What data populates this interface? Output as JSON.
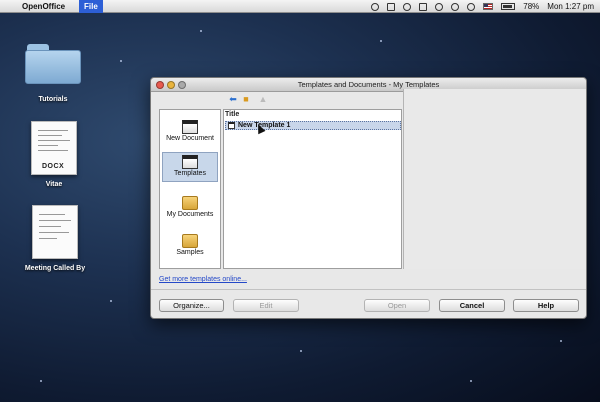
{
  "menubar": {
    "apple_glyph": "",
    "app_name": "OpenOffice",
    "file_menu": "File",
    "status": {
      "battery": "78%",
      "datetime": "Mon 1:27 pm"
    }
  },
  "desktop": {
    "items": [
      {
        "label": "Tutorials",
        "type": "folder"
      },
      {
        "label": "Vitae",
        "type": "docx",
        "badge": "DOCX"
      },
      {
        "label": "Meeting Called By",
        "type": "document"
      }
    ]
  },
  "dialog": {
    "title": "Templates and Documents - My Templates",
    "nav": [
      {
        "label": "New Document",
        "selected": false
      },
      {
        "label": "Templates",
        "selected": true
      },
      {
        "label": "My Documents",
        "selected": false
      },
      {
        "label": "Samples",
        "selected": false
      }
    ],
    "list": {
      "column_title": "Title",
      "rows": [
        "New Template 1"
      ]
    },
    "more_link": "Get more templates online...",
    "buttons": {
      "organize": "Organize...",
      "edit": "Edit",
      "open": "Open",
      "cancel": "Cancel",
      "help": "Help"
    }
  },
  "colors": {
    "selection": "#c9d6ea",
    "link": "#2448c8",
    "menu_highlight": "#2d5fd6"
  }
}
